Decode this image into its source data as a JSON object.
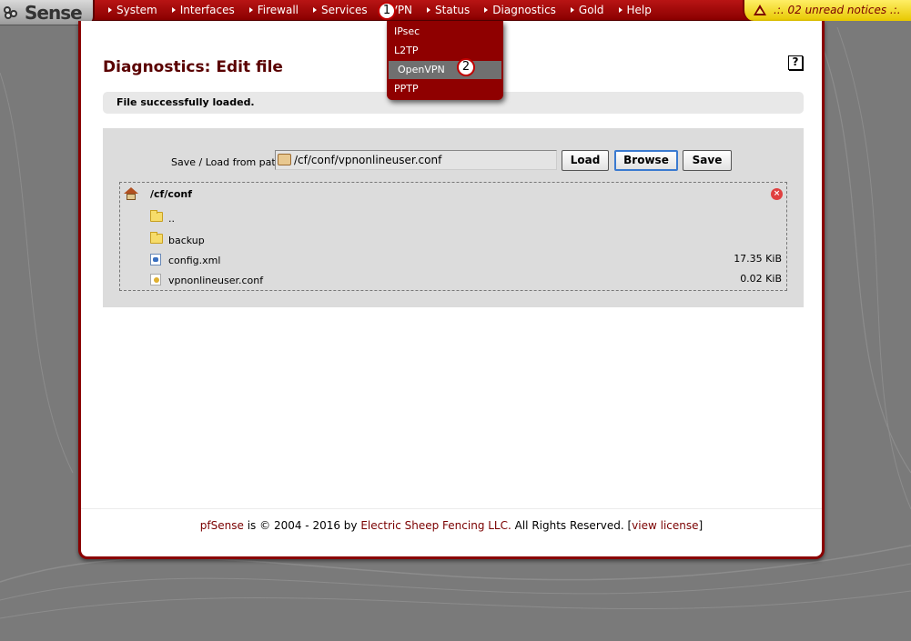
{
  "brand": {
    "logo_text": "Sense"
  },
  "nav": {
    "items": [
      {
        "label": "System"
      },
      {
        "label": "Interfaces"
      },
      {
        "label": "Firewall"
      },
      {
        "label": "Services"
      },
      {
        "label": "VPN"
      },
      {
        "label": "Status"
      },
      {
        "label": "Diagnostics"
      },
      {
        "label": "Gold"
      },
      {
        "label": "Help"
      }
    ],
    "notice": ".:. 02 unread notices .:."
  },
  "vpn_menu": {
    "items": [
      {
        "label": "IPsec"
      },
      {
        "label": "L2TP"
      },
      {
        "label": "OpenVPN",
        "active": true
      },
      {
        "label": "PPTP"
      }
    ]
  },
  "callouts": {
    "first": "1",
    "second": "2"
  },
  "page": {
    "title": "Diagnostics: Edit file",
    "help_icon": "?",
    "message": "File successfully loaded."
  },
  "editor": {
    "path_label": "Save / Load from path:",
    "path_value": "/cf/conf/vpnonlineuser.conf",
    "load_label": "Load",
    "browse_label": "Browse",
    "save_label": "Save"
  },
  "browser": {
    "current_path": "/cf/conf",
    "entries": [
      {
        "name": "..",
        "type": "folder",
        "size": ""
      },
      {
        "name": "backup",
        "type": "folder",
        "size": ""
      },
      {
        "name": "config.xml",
        "type": "xml",
        "size": "17.35 KiB"
      },
      {
        "name": "vpnonlineuser.conf",
        "type": "conf",
        "size": "0.02 KiB"
      }
    ]
  },
  "footer": {
    "product": "pfSense",
    "is": "is",
    "copyright": "© 2004 - 2016 by",
    "company": "Electric Sheep Fencing LLC.",
    "rights": "All Rights Reserved. [",
    "license_link": "view license",
    "close_bracket": "]"
  },
  "colors": {
    "brand_red": "#8a0000",
    "title_red": "#5a0000",
    "notice_yellow": "#ffee66",
    "background_gray": "#7a7a7a"
  },
  "icons": {
    "home": "home-icon",
    "close": "close-icon",
    "folder": "folder-icon",
    "xml": "xml-file-icon",
    "conf": "conf-file-icon",
    "warning": "warning-icon",
    "help": "help-icon"
  }
}
